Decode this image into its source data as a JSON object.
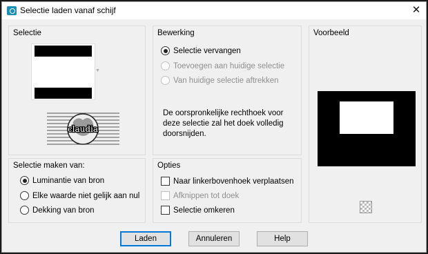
{
  "window": {
    "title": "Selectie laden vanaf schijf"
  },
  "selectie": {
    "label": "Selectie",
    "watermark_text": "claudia"
  },
  "bewerking": {
    "label": "Bewerking",
    "options": [
      {
        "label": "Selectie vervangen",
        "checked": true,
        "enabled": true
      },
      {
        "label": "Toevoegen aan huidige selectie",
        "checked": false,
        "enabled": false
      },
      {
        "label": "Van huidige selectie aftrekken",
        "checked": false,
        "enabled": false
      }
    ],
    "description": "De oorspronkelijke rechthoek voor deze selectie zal het doek volledig doorsnijden."
  },
  "voorbeeld": {
    "label": "Voorbeeld"
  },
  "selectie_maken": {
    "label": "Selectie maken van:",
    "options": [
      {
        "label": "Luminantie van bron",
        "checked": true
      },
      {
        "label": "Elke waarde niet gelijk aan nul",
        "checked": false
      },
      {
        "label": "Dekking van bron",
        "checked": false
      }
    ]
  },
  "opties": {
    "label": "Opties",
    "items": [
      {
        "label": "Naar linkerbovenhoek verplaatsen",
        "checked": false,
        "enabled": true
      },
      {
        "label": "Afknippen tot doek",
        "checked": false,
        "enabled": false
      },
      {
        "label": "Selectie omkeren",
        "checked": false,
        "enabled": true
      }
    ]
  },
  "buttons": {
    "load": "Laden",
    "cancel": "Annuleren",
    "help": "Help"
  }
}
